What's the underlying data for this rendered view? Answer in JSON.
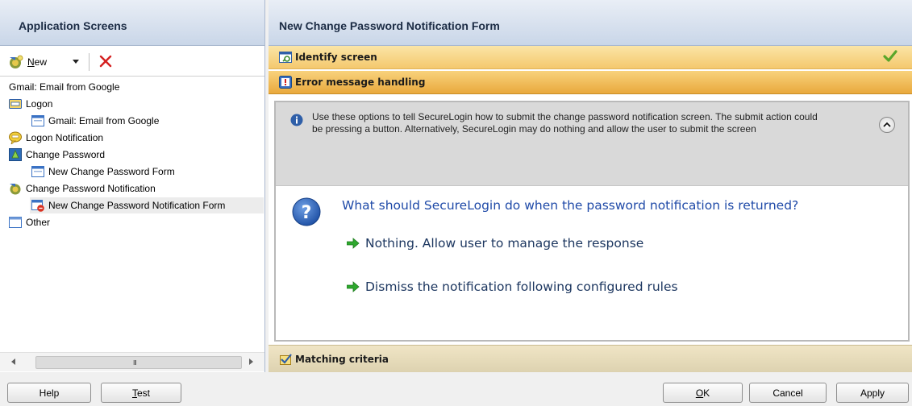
{
  "left_pane": {
    "title": "Application Screens",
    "toolbar": {
      "new_label_first": "N",
      "new_label_rest": "ew"
    },
    "tree": [
      {
        "label": "Gmail: Email from Google",
        "icon": "none",
        "level": 0
      },
      {
        "label": "Logon",
        "icon": "logon-icon",
        "level": 0
      },
      {
        "label": "Gmail: Email from Google",
        "icon": "window-icon",
        "level": 1
      },
      {
        "label": "Logon Notification",
        "icon": "notification-icon",
        "level": 0
      },
      {
        "label": "Change Password",
        "icon": "change-password-icon",
        "level": 0
      },
      {
        "label": "New Change Password Form",
        "icon": "window-icon",
        "level": 1
      },
      {
        "label": "Change Password Notification",
        "icon": "change-password-notification-icon",
        "level": 0
      },
      {
        "label": "New Change Password Notification Form",
        "icon": "window-error-icon",
        "level": 1,
        "selected": true
      },
      {
        "label": "Other",
        "icon": "other-icon",
        "level": 0
      }
    ],
    "scrollbar_grip": "III"
  },
  "right_pane": {
    "title": "New Change Password Notification Form",
    "sections": {
      "identify": {
        "label": "Identify screen",
        "status": "complete"
      },
      "error": {
        "label": "Error message handling"
      },
      "matching": {
        "label": "Matching criteria"
      }
    },
    "info_text": "Use these options to tell SecureLogin how to submit the change password notification screen. The submit action could be pressing a button. Alternatively, SecureLogin may do nothing and allow the user to submit the screen",
    "question": "What should SecureLogin do when the password notification is returned?",
    "options": [
      "Nothing. Allow user to manage the response",
      "Dismiss the notification following configured rules"
    ]
  },
  "buttons": {
    "help": "Help",
    "test_first": "T",
    "test_rest": "est",
    "ok_first": "O",
    "ok_rest": "K",
    "cancel": "Cancel",
    "apply": "Apply"
  },
  "colors": {
    "header_gradient_top": "#e9eef6",
    "header_gradient_bottom": "#c9d6e8",
    "identify_bar": "#f4c86e",
    "error_bar": "#e9a93d",
    "matching_bar": "#ddd2b0",
    "question_text": "#1f4aa8"
  }
}
